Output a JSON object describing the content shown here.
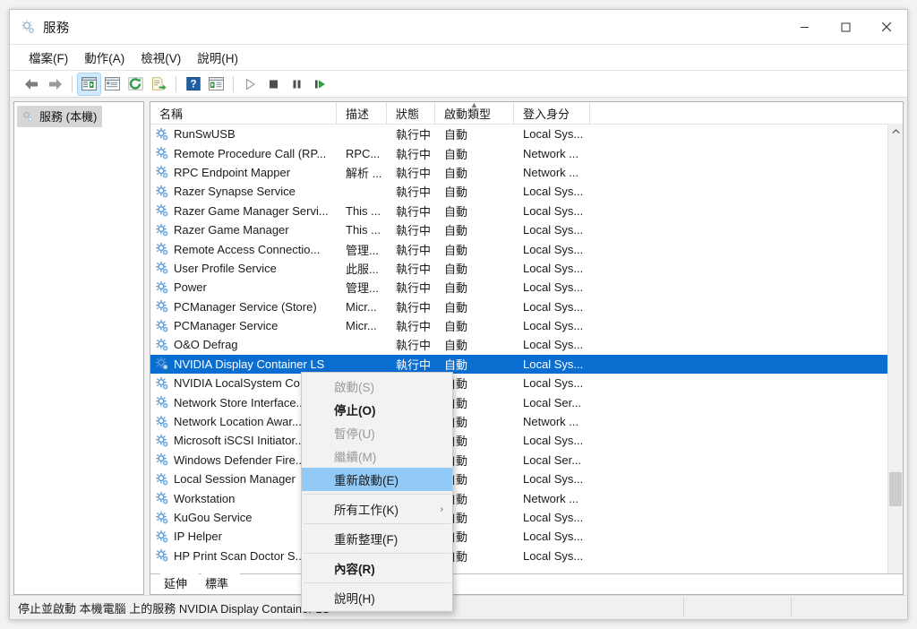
{
  "window": {
    "title": "服務",
    "title_icon": "services-gear-icon",
    "controls": {
      "minimize": "minimize-icon",
      "maximize": "maximize-icon",
      "close": "close-icon"
    }
  },
  "menubar": {
    "items": [
      {
        "label": "檔案(F)",
        "name": "menu-file"
      },
      {
        "label": "動作(A)",
        "name": "menu-action"
      },
      {
        "label": "檢視(V)",
        "name": "menu-view"
      },
      {
        "label": "說明(H)",
        "name": "menu-help"
      }
    ]
  },
  "toolbar": {
    "buttons": [
      {
        "icon": "back-arrow-icon"
      },
      {
        "icon": "forward-arrow-icon"
      },
      {
        "icon": "show-hide-console-tree-icon"
      },
      {
        "icon": "properties-icon"
      },
      {
        "icon": "refresh-icon"
      },
      {
        "icon": "export-list-icon"
      },
      {
        "icon": "help-icon"
      },
      {
        "icon": "show-action-pane-icon"
      },
      {
        "icon": "start-service-icon"
      },
      {
        "icon": "stop-service-icon"
      },
      {
        "icon": "pause-service-icon"
      },
      {
        "icon": "restart-service-icon"
      }
    ]
  },
  "tree": {
    "root_label": "服務 (本機)",
    "root_icon": "services-gear-icon"
  },
  "list": {
    "columns": [
      {
        "key": "name",
        "label": "名稱",
        "sorted": false
      },
      {
        "key": "desc",
        "label": "描述",
        "sorted": false
      },
      {
        "key": "state",
        "label": "狀態",
        "sorted": false
      },
      {
        "key": "start",
        "label": "啟動類型",
        "sorted": true,
        "sort_dir": "asc"
      },
      {
        "key": "logon",
        "label": "登入身分",
        "sorted": false
      }
    ],
    "rows": [
      {
        "name": "RunSwUSB",
        "desc": "",
        "state": "執行中",
        "start": "自動",
        "logon": "Local Sys...",
        "selected": false
      },
      {
        "name": "Remote Procedure Call (RP...",
        "desc": "RPC...",
        "state": "執行中",
        "start": "自動",
        "logon": "Network ...",
        "selected": false
      },
      {
        "name": "RPC Endpoint Mapper",
        "desc": "解析 ...",
        "state": "執行中",
        "start": "自動",
        "logon": "Network ...",
        "selected": false
      },
      {
        "name": "Razer Synapse Service",
        "desc": "",
        "state": "執行中",
        "start": "自動",
        "logon": "Local Sys...",
        "selected": false
      },
      {
        "name": "Razer Game Manager Servi...",
        "desc": "This ...",
        "state": "執行中",
        "start": "自動",
        "logon": "Local Sys...",
        "selected": false
      },
      {
        "name": "Razer Game Manager",
        "desc": "This ...",
        "state": "執行中",
        "start": "自動",
        "logon": "Local Sys...",
        "selected": false
      },
      {
        "name": "Remote Access Connectio...",
        "desc": "管理...",
        "state": "執行中",
        "start": "自動",
        "logon": "Local Sys...",
        "selected": false
      },
      {
        "name": "User Profile Service",
        "desc": "此服...",
        "state": "執行中",
        "start": "自動",
        "logon": "Local Sys...",
        "selected": false
      },
      {
        "name": "Power",
        "desc": "管理...",
        "state": "執行中",
        "start": "自動",
        "logon": "Local Sys...",
        "selected": false
      },
      {
        "name": "PCManager Service (Store)",
        "desc": "Micr...",
        "state": "執行中",
        "start": "自動",
        "logon": "Local Sys...",
        "selected": false
      },
      {
        "name": "PCManager Service",
        "desc": "Micr...",
        "state": "執行中",
        "start": "自動",
        "logon": "Local Sys...",
        "selected": false
      },
      {
        "name": "O&O Defrag",
        "desc": "",
        "state": "執行中",
        "start": "自動",
        "logon": "Local Sys...",
        "selected": false
      },
      {
        "name": "NVIDIA Display Container LS",
        "desc": "",
        "state": "執行中",
        "start": "自動",
        "logon": "Local Sys...",
        "selected": true
      },
      {
        "name": "NVIDIA LocalSystem Co...",
        "desc": "",
        "state": "",
        "start": "自動",
        "logon": "Local Sys...",
        "selected": false
      },
      {
        "name": "Network Store Interface...",
        "desc": "",
        "state": "",
        "start": "自動",
        "logon": "Local Ser...",
        "selected": false
      },
      {
        "name": "Network Location Awar...",
        "desc": "",
        "state": "",
        "start": "自動",
        "logon": "Network ...",
        "selected": false
      },
      {
        "name": "Microsoft iSCSI Initiator...",
        "desc": "",
        "state": "",
        "start": "自動",
        "logon": "Local Sys...",
        "selected": false
      },
      {
        "name": "Windows Defender Fire...",
        "desc": "",
        "state": "",
        "start": "自動",
        "logon": "Local Ser...",
        "selected": false
      },
      {
        "name": "Local Session Manager",
        "desc": "",
        "state": "",
        "start": "自動",
        "logon": "Local Sys...",
        "selected": false
      },
      {
        "name": "Workstation",
        "desc": "",
        "state": "",
        "start": "自動",
        "logon": "Network ...",
        "selected": false
      },
      {
        "name": "KuGou Service",
        "desc": "",
        "state": "",
        "start": "自動",
        "logon": "Local Sys...",
        "selected": false
      },
      {
        "name": "IP Helper",
        "desc": "",
        "state": "",
        "start": "自動",
        "logon": "Local Sys...",
        "selected": false
      },
      {
        "name": "HP Print Scan Doctor S...",
        "desc": "",
        "state": "",
        "start": "自動",
        "logon": "Local Sys...",
        "selected": false
      }
    ],
    "scrollbar": {
      "up_arrow": "chevron-up-icon",
      "down_arrow": "chevron-down-icon"
    }
  },
  "tabs": [
    {
      "label": "延伸",
      "active": false
    },
    {
      "label": "標準",
      "active": true
    }
  ],
  "context_menu": {
    "items": [
      {
        "label": "啟動(S)",
        "disabled": true,
        "bold": false,
        "highlight": false,
        "submenu": false
      },
      {
        "label": "停止(O)",
        "disabled": false,
        "bold": true,
        "highlight": false,
        "submenu": false
      },
      {
        "label": "暫停(U)",
        "disabled": true,
        "bold": false,
        "highlight": false,
        "submenu": false
      },
      {
        "label": "繼續(M)",
        "disabled": true,
        "bold": false,
        "highlight": false,
        "submenu": false
      },
      {
        "label": "重新啟動(E)",
        "disabled": false,
        "bold": false,
        "highlight": true,
        "submenu": false
      },
      {
        "separator": true
      },
      {
        "label": "所有工作(K)",
        "disabled": false,
        "bold": false,
        "highlight": false,
        "submenu": true
      },
      {
        "separator": true
      },
      {
        "label": "重新整理(F)",
        "disabled": false,
        "bold": false,
        "highlight": false,
        "submenu": false
      },
      {
        "separator": true
      },
      {
        "label": "內容(R)",
        "disabled": false,
        "bold": true,
        "highlight": false,
        "submenu": false
      },
      {
        "separator": true
      },
      {
        "label": "說明(H)",
        "disabled": false,
        "bold": false,
        "highlight": false,
        "submenu": false
      }
    ],
    "submenu_arrow": "chevron-right-icon"
  },
  "statusbar": {
    "text": "停止並啟動 本機電腦 上的服務 NVIDIA Display Container LS"
  },
  "colors": {
    "selection_blue": "#0a6ed1",
    "menu_highlight": "#91c9f7",
    "toolbar_active": "#cfe8fb",
    "window_bg": "#ffffff",
    "chrome_gray": "#f0f0f0"
  }
}
